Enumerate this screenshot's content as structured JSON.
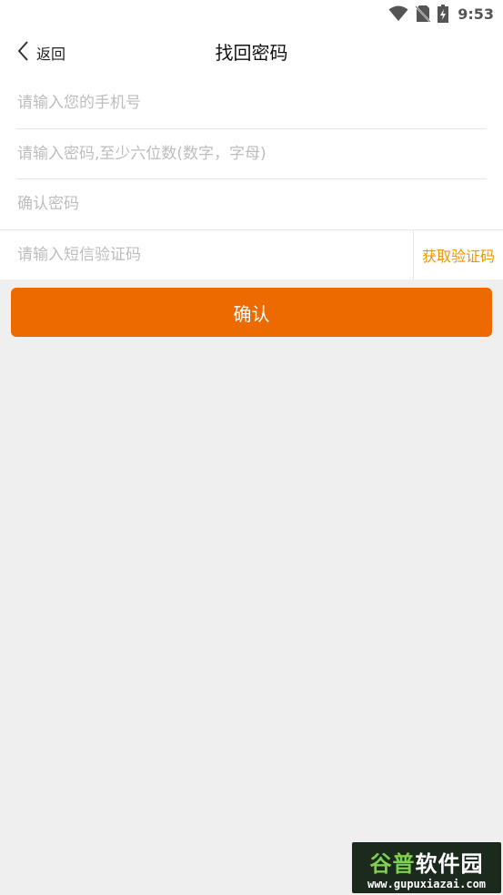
{
  "status_bar": {
    "time": "9:53",
    "icons": [
      "wifi-icon",
      "no-sim-icon",
      "battery-charging-icon"
    ]
  },
  "header": {
    "back_label": "返回",
    "title": "找回密码"
  },
  "form": {
    "phone_placeholder": "请输入您的手机号",
    "password_placeholder": "请输入密码,至少六位数(数字，字母)",
    "confirm_password_placeholder": "确认密码",
    "sms_code_placeholder": "请输入短信验证码",
    "get_code_label": "获取验证码"
  },
  "confirm_label": "确认",
  "watermark": {
    "brand_part1": "谷普",
    "brand_part2": "软件园",
    "url": "www.gupuxiazai.com"
  },
  "colors": {
    "accent": "#ec6a00",
    "get_code_text": "#f29500",
    "background": "#efefef"
  }
}
